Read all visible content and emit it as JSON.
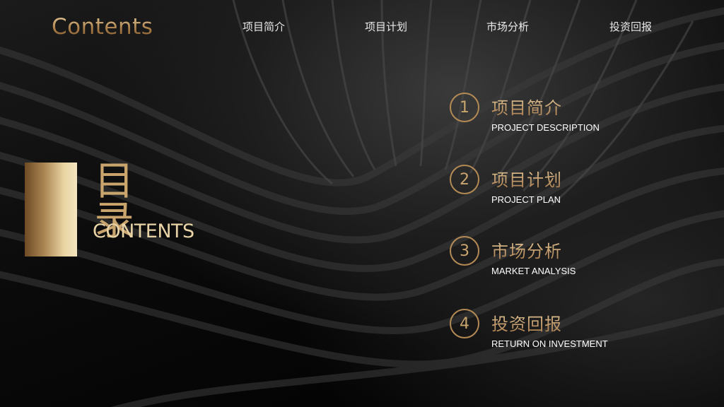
{
  "logo": "Contents",
  "nav": {
    "items": [
      {
        "label": "项目简介"
      },
      {
        "label": "项目计划"
      },
      {
        "label": "市场分析"
      },
      {
        "label": "投资回报"
      }
    ]
  },
  "title": {
    "cn": "目录",
    "en": "CONTENTS"
  },
  "sections": [
    {
      "number": "1",
      "title": "项目简介",
      "subtitle": "PROJECT DESCRIPTION"
    },
    {
      "number": "2",
      "title": "项目计划",
      "subtitle": "PROJECT PLAN"
    },
    {
      "number": "3",
      "title": "市场分析",
      "subtitle": "MARKET ANALYSIS"
    },
    {
      "number": "4",
      "title": "投资回报",
      "subtitle": "RETURN ON INVESTMENT"
    }
  ],
  "colors": {
    "gold": "#c9a46d",
    "background": "#050505"
  }
}
